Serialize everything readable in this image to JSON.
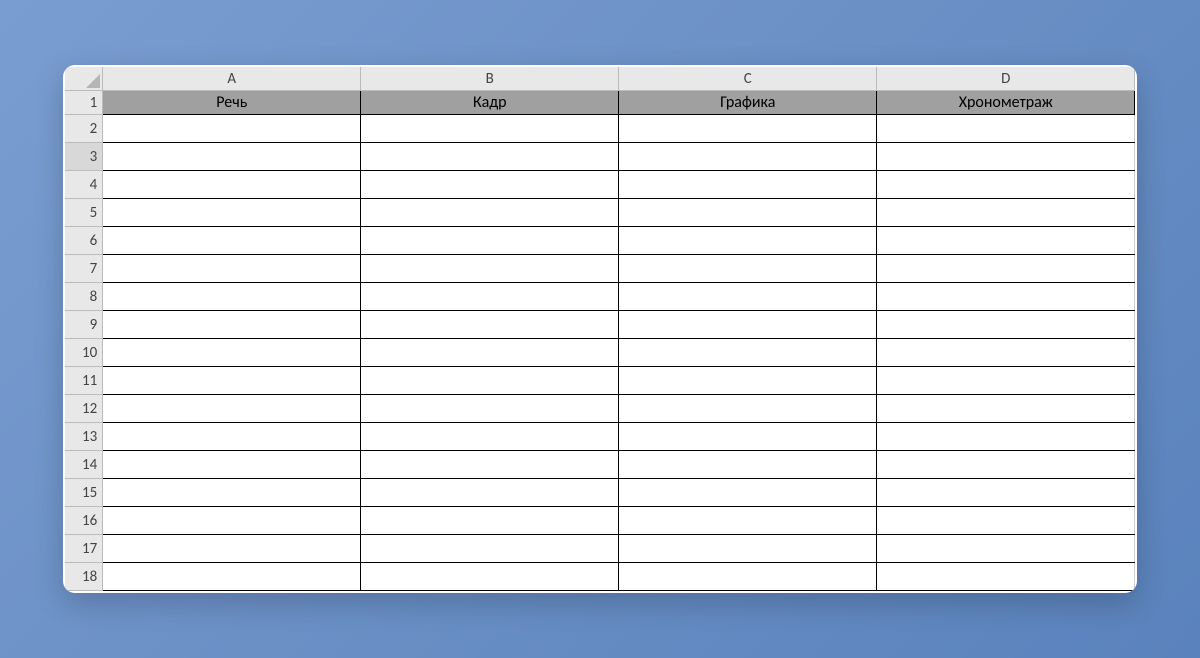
{
  "columns": [
    "A",
    "B",
    "C",
    "D"
  ],
  "rowNumbers": [
    "1",
    "2",
    "3",
    "4",
    "5",
    "6",
    "7",
    "8",
    "9",
    "10",
    "11",
    "12",
    "13",
    "14",
    "15",
    "16",
    "17",
    "18"
  ],
  "headerRow": {
    "A": "Речь",
    "B": "Кадр",
    "C": "Графика",
    "D": "Хронометраж"
  },
  "selectedRow": 3,
  "cells": {}
}
